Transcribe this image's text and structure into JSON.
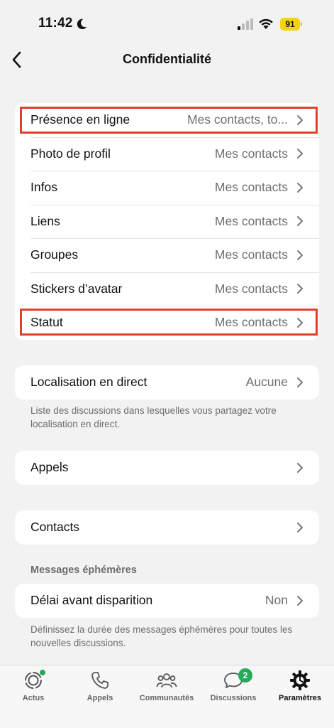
{
  "status_bar": {
    "time": "11:42",
    "battery": "91",
    "icons": [
      "moon-icon",
      "cellular-signal-icon",
      "wifi-icon",
      "battery-icon"
    ]
  },
  "nav": {
    "title": "Confidentialité",
    "back_icon": "chevron-left-icon"
  },
  "privacy_group": [
    {
      "label": "Présence en ligne",
      "value": "Mes contacts, to...",
      "highlighted": true
    },
    {
      "label": "Photo de profil",
      "value": "Mes contacts"
    },
    {
      "label": "Infos",
      "value": "Mes contacts"
    },
    {
      "label": "Liens",
      "value": "Mes contacts"
    },
    {
      "label": "Groupes",
      "value": "Mes contacts"
    },
    {
      "label": "Stickers d’avatar",
      "value": "Mes contacts"
    },
    {
      "label": "Statut",
      "value": "Mes contacts",
      "highlighted": true
    }
  ],
  "live_location": {
    "label": "Localisation en direct",
    "value": "Aucune",
    "footnote": "Liste des discussions dans lesquelles vous partagez votre localisation en direct."
  },
  "calls": {
    "label": "Appels"
  },
  "contacts": {
    "label": "Contacts"
  },
  "disappearing": {
    "section_title": "Messages éphémères",
    "label": "Délai avant disparition",
    "value": "Non",
    "footnote": "Définissez la durée des messages éphémères pour toutes les nouvelles discussions."
  },
  "tab_bar": {
    "tabs": [
      {
        "label": "Actus",
        "icon": "updates-icon"
      },
      {
        "label": "Appels",
        "icon": "phone-icon"
      },
      {
        "label": "Communautés",
        "icon": "communities-icon"
      },
      {
        "label": "Discussions",
        "icon": "chats-icon",
        "badge": "2"
      },
      {
        "label": "Paramètres",
        "icon": "settings-gear-icon",
        "active": true
      }
    ]
  },
  "colors": {
    "background": "#f2f2f2",
    "card": "#ffffff",
    "highlight_border": "#e0402a",
    "badge_green": "#25a95b",
    "battery_yellow": "#f5d21a"
  }
}
